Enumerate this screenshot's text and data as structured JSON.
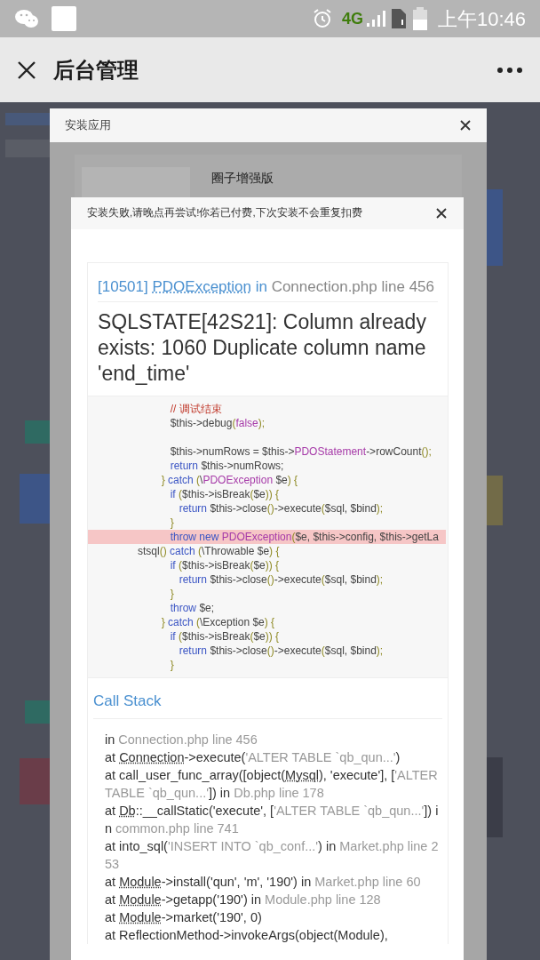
{
  "status_bar": {
    "network": "4G",
    "time": "上午10:46"
  },
  "header": {
    "title": "后台管理"
  },
  "install_dialog": {
    "title": "安装应用",
    "product_name": "圈子增强版"
  },
  "error_dialog": {
    "title": "安装失败,请晚点再尝试!你若已付费,下次安装不会重复扣费",
    "exception": {
      "code": "[10501]",
      "class": "PDOException",
      "in": "in",
      "location": "Connection.php line 456"
    },
    "message": "SQLSTATE[42S21]: Column already exists: 1060 Duplicate column name 'end_time'",
    "source_lines": [
      {
        "highlighted": false,
        "tokens": [
          {
            "kind": "comment",
            "text": "           // 调试结束"
          }
        ]
      },
      {
        "highlighted": false,
        "tokens": [
          {
            "kind": "plain",
            "text": "           $this->debug"
          },
          {
            "kind": "punct",
            "text": "("
          },
          {
            "kind": "literal",
            "text": "false"
          },
          {
            "kind": "punct",
            "text": ");"
          }
        ]
      },
      {
        "kind": "blank"
      },
      {
        "highlighted": false,
        "tokens": [
          {
            "kind": "plain",
            "text": "           $this->numRows = $this->"
          },
          {
            "kind": "literal",
            "text": "PDOStatement"
          },
          {
            "kind": "plain",
            "text": "->rowCount"
          },
          {
            "kind": "punct",
            "text": "();"
          }
        ]
      },
      {
        "highlighted": false,
        "tokens": [
          {
            "kind": "keyword",
            "text": "           return "
          },
          {
            "kind": "plain",
            "text": "$this->numRows;"
          }
        ]
      },
      {
        "highlighted": false,
        "tokens": [
          {
            "kind": "punct",
            "text": "        } "
          },
          {
            "kind": "keyword",
            "text": "catch "
          },
          {
            "kind": "punct",
            "text": "("
          },
          {
            "kind": "plain",
            "text": "\\"
          },
          {
            "kind": "literal",
            "text": "PDOException"
          },
          {
            "kind": "plain",
            "text": " $e"
          },
          {
            "kind": "punct",
            "text": ") {"
          }
        ]
      },
      {
        "highlighted": false,
        "tokens": [
          {
            "kind": "keyword",
            "text": "           if "
          },
          {
            "kind": "punct",
            "text": "("
          },
          {
            "kind": "plain",
            "text": "$this->isBreak"
          },
          {
            "kind": "punct",
            "text": "("
          },
          {
            "kind": "plain",
            "text": "$e"
          },
          {
            "kind": "punct",
            "text": ")) {"
          }
        ]
      },
      {
        "highlighted": false,
        "tokens": [
          {
            "kind": "keyword",
            "text": "              return "
          },
          {
            "kind": "plain",
            "text": "$this->close"
          },
          {
            "kind": "punct",
            "text": "()"
          },
          {
            "kind": "plain",
            "text": "->execute"
          },
          {
            "kind": "punct",
            "text": "("
          },
          {
            "kind": "plain",
            "text": "$sql, $bind"
          },
          {
            "kind": "punct",
            "text": ");"
          }
        ]
      },
      {
        "highlighted": false,
        "tokens": [
          {
            "kind": "punct",
            "text": "           }"
          }
        ]
      },
      {
        "highlighted": true,
        "tokens": [
          {
            "kind": "keyword",
            "text": "           throw new "
          },
          {
            "kind": "literal",
            "text": "PDOException"
          },
          {
            "kind": "punct",
            "text": "("
          },
          {
            "kind": "plain",
            "text": "$e, $this->config, $this->getLa"
          }
        ]
      },
      {
        "highlighted": false,
        "tokens": [
          {
            "kind": "plain",
            "text": "stsql"
          },
          {
            "kind": "punct",
            "text": "() "
          },
          {
            "kind": "keyword",
            "text": "catch "
          },
          {
            "kind": "punct",
            "text": "("
          },
          {
            "kind": "plain",
            "text": "\\Throwable $e"
          },
          {
            "kind": "punct",
            "text": ") {"
          }
        ]
      },
      {
        "highlighted": false,
        "tokens": [
          {
            "kind": "keyword",
            "text": "           if "
          },
          {
            "kind": "punct",
            "text": "("
          },
          {
            "kind": "plain",
            "text": "$this->isBreak"
          },
          {
            "kind": "punct",
            "text": "("
          },
          {
            "kind": "plain",
            "text": "$e"
          },
          {
            "kind": "punct",
            "text": ")) {"
          }
        ]
      },
      {
        "highlighted": false,
        "tokens": [
          {
            "kind": "keyword",
            "text": "              return "
          },
          {
            "kind": "plain",
            "text": "$this->close"
          },
          {
            "kind": "punct",
            "text": "()"
          },
          {
            "kind": "plain",
            "text": "->execute"
          },
          {
            "kind": "punct",
            "text": "("
          },
          {
            "kind": "plain",
            "text": "$sql, $bind"
          },
          {
            "kind": "punct",
            "text": ");"
          }
        ]
      },
      {
        "highlighted": false,
        "tokens": [
          {
            "kind": "punct",
            "text": "           }"
          }
        ]
      },
      {
        "highlighted": false,
        "tokens": [
          {
            "kind": "keyword",
            "text": "           throw "
          },
          {
            "kind": "plain",
            "text": "$e;"
          }
        ]
      },
      {
        "highlighted": false,
        "tokens": [
          {
            "kind": "punct",
            "text": "        } "
          },
          {
            "kind": "keyword",
            "text": "catch "
          },
          {
            "kind": "punct",
            "text": "("
          },
          {
            "kind": "plain",
            "text": "\\Exception $e"
          },
          {
            "kind": "punct",
            "text": ") {"
          }
        ]
      },
      {
        "highlighted": false,
        "tokens": [
          {
            "kind": "keyword",
            "text": "           if "
          },
          {
            "kind": "punct",
            "text": "("
          },
          {
            "kind": "plain",
            "text": "$this->isBreak"
          },
          {
            "kind": "punct",
            "text": "("
          },
          {
            "kind": "plain",
            "text": "$e"
          },
          {
            "kind": "punct",
            "text": ")) {"
          }
        ]
      },
      {
        "highlighted": false,
        "tokens": [
          {
            "kind": "keyword",
            "text": "              return "
          },
          {
            "kind": "plain",
            "text": "$this->close"
          },
          {
            "kind": "punct",
            "text": "()"
          },
          {
            "kind": "plain",
            "text": "->execute"
          },
          {
            "kind": "punct",
            "text": "("
          },
          {
            "kind": "plain",
            "text": "$sql, $bind"
          },
          {
            "kind": "punct",
            "text": ");"
          }
        ]
      },
      {
        "highlighted": false,
        "tokens": [
          {
            "kind": "punct",
            "text": "           }"
          }
        ]
      }
    ],
    "call_stack": {
      "title": "Call Stack",
      "frames": [
        {
          "parts": [
            {
              "kind": "text",
              "text": "in "
            },
            {
              "kind": "file",
              "text": "Connection.php line 456"
            }
          ]
        },
        {
          "parts": [
            {
              "kind": "text",
              "text": "at "
            },
            {
              "kind": "class",
              "text": "Connection"
            },
            {
              "kind": "text",
              "text": "->execute("
            },
            {
              "kind": "string",
              "text": "'ALTER TABLE `qb_qun...'"
            },
            {
              "kind": "text",
              "text": ")"
            }
          ]
        },
        {
          "parts": [
            {
              "kind": "text",
              "text": "at call_user_func_array([object("
            },
            {
              "kind": "class",
              "text": "Mysql"
            },
            {
              "kind": "text",
              "text": "), 'execute'], ["
            },
            {
              "kind": "string",
              "text": "'ALTER TABLE `qb_qun...'"
            },
            {
              "kind": "text",
              "text": "]) in "
            },
            {
              "kind": "file",
              "text": "Db.php line 178"
            }
          ]
        },
        {
          "parts": [
            {
              "kind": "text",
              "text": "at "
            },
            {
              "kind": "class",
              "text": "Db"
            },
            {
              "kind": "text",
              "text": "::__callStatic('execute', ["
            },
            {
              "kind": "string",
              "text": "'ALTER TABLE `qb_qun...'"
            },
            {
              "kind": "text",
              "text": "]) in "
            },
            {
              "kind": "file",
              "text": "common.php line 741"
            }
          ]
        },
        {
          "parts": [
            {
              "kind": "text",
              "text": "at into_sql("
            },
            {
              "kind": "string",
              "text": "'INSERT INTO `qb_conf...'"
            },
            {
              "kind": "text",
              "text": ") in "
            },
            {
              "kind": "file",
              "text": "Market.php line 253"
            }
          ]
        },
        {
          "parts": [
            {
              "kind": "text",
              "text": "at "
            },
            {
              "kind": "class",
              "text": "Module"
            },
            {
              "kind": "text",
              "text": "->install('qun', 'm', '190') in "
            },
            {
              "kind": "file",
              "text": "Market.php line 60"
            }
          ]
        },
        {
          "parts": [
            {
              "kind": "text",
              "text": "at "
            },
            {
              "kind": "class",
              "text": "Module"
            },
            {
              "kind": "text",
              "text": "->getapp('190') in "
            },
            {
              "kind": "file",
              "text": "Module.php line 128"
            }
          ]
        },
        {
          "parts": [
            {
              "kind": "text",
              "text": "at "
            },
            {
              "kind": "class",
              "text": "Module"
            },
            {
              "kind": "text",
              "text": "->market('190', 0)"
            }
          ]
        },
        {
          "parts": [
            {
              "kind": "text",
              "text": "at ReflectionMethod->invokeArgs(object(Module),"
            }
          ]
        }
      ]
    }
  }
}
